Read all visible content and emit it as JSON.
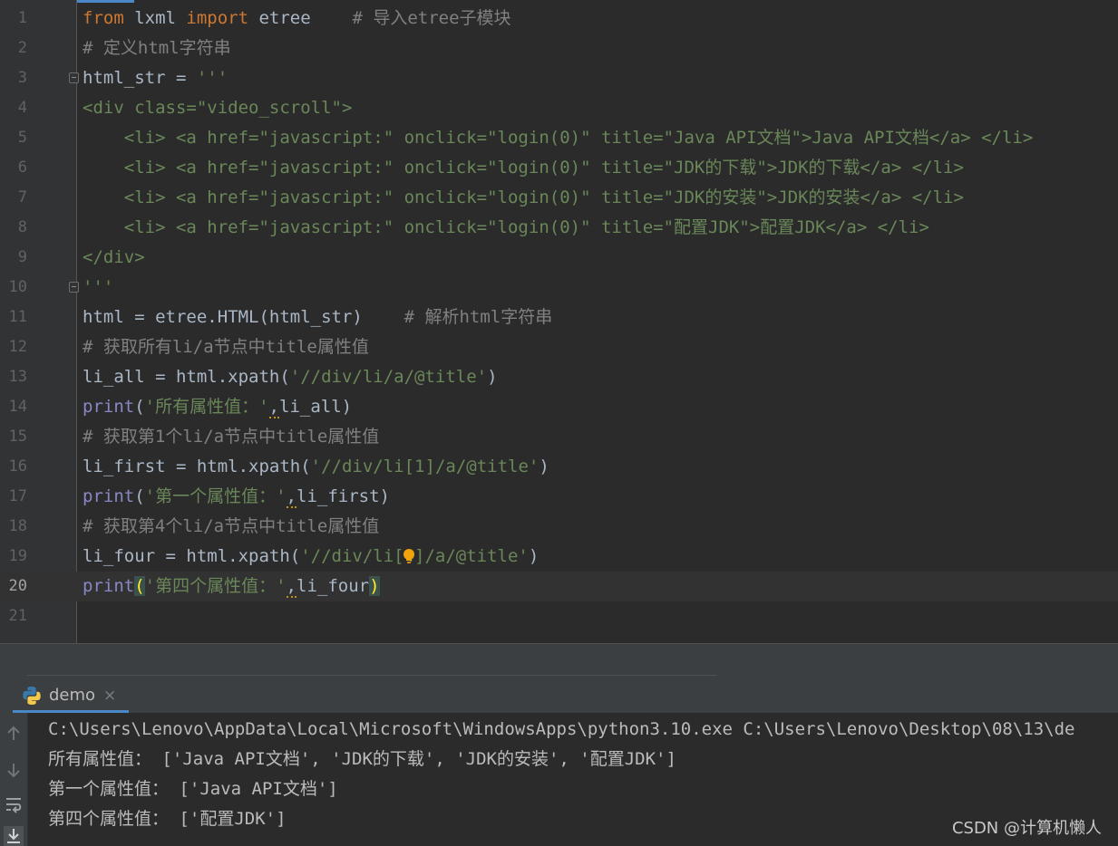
{
  "editor": {
    "line_numbers": [
      "1",
      "2",
      "3",
      "4",
      "5",
      "6",
      "7",
      "8",
      "9",
      "10",
      "11",
      "12",
      "13",
      "14",
      "15",
      "16",
      "17",
      "18",
      "19",
      "20",
      "21"
    ],
    "current_line": "20",
    "lines": {
      "l1": {
        "kw1": "from",
        "mod": " lxml ",
        "kw2": "import",
        "mod2": " etree",
        "cmt": "    # 导入etree子模块"
      },
      "l2": {
        "cmt": "# 定义html字符串"
      },
      "l3": {
        "var": "html_str = ",
        "str": "'''"
      },
      "l4": {
        "text": "<div class=\"video_scroll\">"
      },
      "l5": {
        "text": "    <li> <a href=\"javascript:\" onclick=\"login(0)\" title=\"Java API文档\">Java API文档</a> </li>"
      },
      "l6": {
        "text": "    <li> <a href=\"javascript:\" onclick=\"login(0)\" title=\"JDK的下载\">JDK的下载</a> </li>"
      },
      "l7": {
        "text": "    <li> <a href=\"javascript:\" onclick=\"login(0)\" title=\"JDK的安装\">JDK的安装</a> </li>"
      },
      "l8": {
        "text": "    <li> <a href=\"javascript:\" onclick=\"login(0)\" title=\"配置JDK\">配置JDK</a> </li>"
      },
      "l9": {
        "text": "</div>"
      },
      "l10": {
        "text": "'''"
      },
      "l11": {
        "code": "html = etree.HTML(html_str)",
        "cmt": "    # 解析html字符串"
      },
      "l12": {
        "cmt": "# 获取所有li/a节点中title属性值"
      },
      "l13": {
        "pre": "li_all = html.xpath(",
        "str": "'//div/li/a/@title'",
        "post": ")"
      },
      "l14": {
        "fn": "print",
        "open": "(",
        "str": "'所有属性值：'",
        "comma": ",",
        "arg": "li_all",
        "close": ")"
      },
      "l15": {
        "cmt": "# 获取第1个li/a节点中title属性值"
      },
      "l16": {
        "pre": "li_first = html.xpath(",
        "str": "'//div/li[1]/a/@title'",
        "post": ")"
      },
      "l17": {
        "fn": "print",
        "open": "(",
        "str": "'第一个属性值：'",
        "comma": ",",
        "arg": "li_first",
        "close": ")"
      },
      "l18": {
        "cmt": "# 获取第4个li/a节点中title属性值"
      },
      "l19": {
        "pre": "li_four = html.xpath(",
        "str": "'//div/li[4]/a/@title'",
        "post": ")"
      },
      "l20": {
        "fn": "print",
        "open": "(",
        "str": "'第四个属性值：'",
        "comma": ",",
        "arg": "li_four",
        "close": ")"
      }
    }
  },
  "run_panel": {
    "tab_label": "demo",
    "close_glyph": "×",
    "output": [
      "C:\\Users\\Lenovo\\AppData\\Local\\Microsoft\\WindowsApps\\python3.10.exe C:\\Users\\Lenovo\\Desktop\\08\\13\\de",
      "所有属性值： ['Java API文档', 'JDK的下载', 'JDK的安装', '配置JDK']",
      "第一个属性值： ['Java API文档']",
      "第四个属性值： ['配置JDK']"
    ]
  },
  "watermark": "CSDN @计算机懒人",
  "colors": {
    "accent": "#4a88c7",
    "keyword": "#cc7832",
    "string": "#6a8759",
    "comment": "#808080",
    "tag": "#e8bf6a"
  },
  "icons": [
    "python-icon",
    "scroll-up-icon",
    "scroll-down-icon",
    "soft-wrap-icon",
    "scroll-to-end-icon",
    "intention-bulb-icon",
    "fold-marker-icon"
  ]
}
